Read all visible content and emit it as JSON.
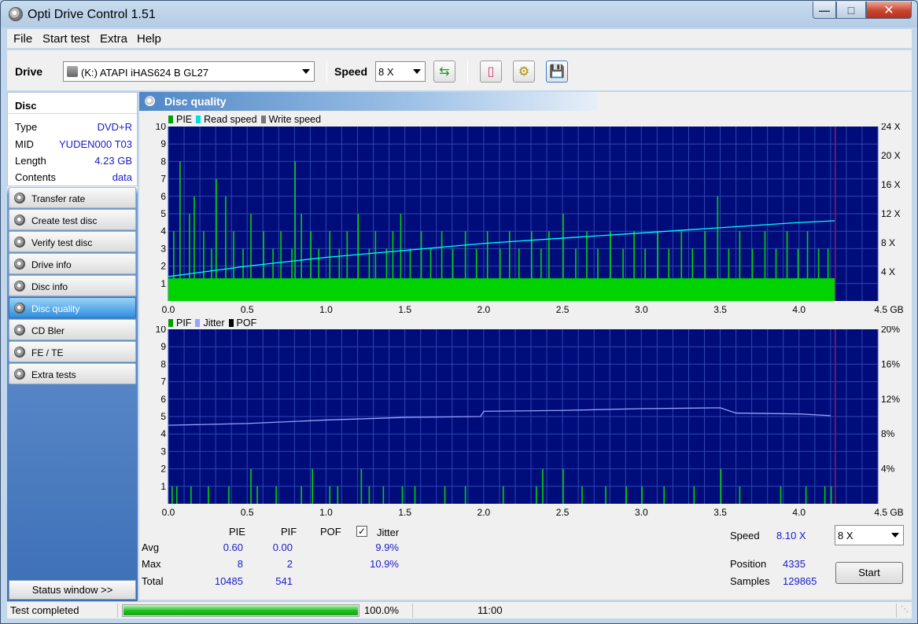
{
  "window": {
    "title": "Opti Drive Control 1.51"
  },
  "menu": [
    "File",
    "Start test",
    "Extra",
    "Help"
  ],
  "toolbar": {
    "drive_label": "Drive",
    "drive_value": "(K:)   ATAPI iHAS624   B GL27",
    "speed_label": "Speed",
    "speed_value": "8 X",
    "buttons": [
      "refresh-icon",
      "eraser-icon",
      "settings-icon",
      "save-icon"
    ]
  },
  "disc": {
    "title": "Disc",
    "rows": [
      {
        "label": "Type",
        "value": "DVD+R"
      },
      {
        "label": "MID",
        "value": "YUDEN000 T03"
      },
      {
        "label": "Length",
        "value": "4.23 GB"
      },
      {
        "label": "Contents",
        "value": "data"
      }
    ]
  },
  "nav": [
    {
      "label": "Transfer rate",
      "active": false
    },
    {
      "label": "Create test disc",
      "active": false
    },
    {
      "label": "Verify test disc",
      "active": false
    },
    {
      "label": "Drive info",
      "active": false
    },
    {
      "label": "Disc info",
      "active": false
    },
    {
      "label": "Disc quality",
      "active": true
    },
    {
      "label": "CD Bler",
      "active": false
    },
    {
      "label": "FE / TE",
      "active": false
    },
    {
      "label": "Extra tests",
      "active": false
    }
  ],
  "status_window_label": "Status window >>",
  "panel_title": "Disc quality",
  "colors": {
    "plot_bg": "#000c7a",
    "grid": "#2f46b4",
    "pie": "#00d400",
    "read_speed": "#00ffff",
    "jitter": "#9aa0ff",
    "end_line": "#8a1a6a"
  },
  "chart_data": [
    {
      "type": "bar",
      "legend": [
        "PIE",
        "Read speed",
        "Write speed"
      ],
      "xlim": [
        0,
        4.5
      ],
      "xticks": [
        "0.0",
        "0.5",
        "1.0",
        "1.5",
        "2.0",
        "2.5",
        "3.0",
        "3.5",
        "4.0",
        "4.5 GB"
      ],
      "ylim": [
        0,
        10
      ],
      "yticks": [
        "1",
        "2",
        "3",
        "4",
        "5",
        "6",
        "7",
        "8",
        "9",
        "10"
      ],
      "y2ticks": [
        "4 X",
        "8 X",
        "12 X",
        "16 X",
        "20 X",
        "24 X"
      ],
      "data_end": 4.23,
      "pie_base": 1.3,
      "pie_spikes": [
        [
          0.03,
          4
        ],
        [
          0.07,
          8
        ],
        [
          0.13,
          5
        ],
        [
          0.16,
          6
        ],
        [
          0.22,
          4
        ],
        [
          0.27,
          3
        ],
        [
          0.3,
          7
        ],
        [
          0.36,
          6
        ],
        [
          0.41,
          4
        ],
        [
          0.47,
          3
        ],
        [
          0.52,
          5
        ],
        [
          0.6,
          4
        ],
        [
          0.66,
          3
        ],
        [
          0.71,
          4
        ],
        [
          0.78,
          3
        ],
        [
          0.8,
          8
        ],
        [
          0.84,
          5
        ],
        [
          0.9,
          4
        ],
        [
          0.95,
          3
        ],
        [
          1.02,
          4
        ],
        [
          1.08,
          3
        ],
        [
          1.13,
          4
        ],
        [
          1.2,
          5
        ],
        [
          1.27,
          3
        ],
        [
          1.31,
          4
        ],
        [
          1.38,
          3
        ],
        [
          1.42,
          4
        ],
        [
          1.47,
          5
        ],
        [
          1.53,
          3
        ],
        [
          1.6,
          4
        ],
        [
          1.66,
          3
        ],
        [
          1.73,
          4
        ],
        [
          1.8,
          3
        ],
        [
          1.88,
          4
        ],
        [
          1.95,
          3
        ],
        [
          2.02,
          4
        ],
        [
          2.1,
          3
        ],
        [
          2.16,
          4
        ],
        [
          2.22,
          3
        ],
        [
          2.3,
          4
        ],
        [
          2.36,
          3
        ],
        [
          2.41,
          4
        ],
        [
          2.5,
          5
        ],
        [
          2.58,
          3
        ],
        [
          2.65,
          4
        ],
        [
          2.72,
          3
        ],
        [
          2.8,
          4
        ],
        [
          2.88,
          3
        ],
        [
          2.95,
          4
        ],
        [
          3.02,
          3
        ],
        [
          3.1,
          4
        ],
        [
          3.17,
          3
        ],
        [
          3.25,
          4
        ],
        [
          3.32,
          3
        ],
        [
          3.4,
          4
        ],
        [
          3.48,
          6
        ],
        [
          3.55,
          3
        ],
        [
          3.62,
          4
        ],
        [
          3.7,
          3
        ],
        [
          3.78,
          4
        ],
        [
          3.85,
          3
        ],
        [
          3.92,
          4
        ],
        [
          3.99,
          3
        ],
        [
          4.05,
          4
        ],
        [
          4.12,
          3
        ],
        [
          4.18,
          3
        ]
      ],
      "read_speed": [
        [
          0,
          1.4
        ],
        [
          0.5,
          2.0
        ],
        [
          1.0,
          2.5
        ],
        [
          1.5,
          2.9
        ],
        [
          2.0,
          3.3
        ],
        [
          2.5,
          3.6
        ],
        [
          3.0,
          3.9
        ],
        [
          3.5,
          4.2
        ],
        [
          4.0,
          4.5
        ],
        [
          4.23,
          4.6
        ]
      ]
    },
    {
      "type": "bar",
      "legend": [
        "PIF",
        "Jitter",
        "POF"
      ],
      "xlim": [
        0,
        4.5
      ],
      "xticks": [
        "0.0",
        "0.5",
        "1.0",
        "1.5",
        "2.0",
        "2.5",
        "3.0",
        "3.5",
        "4.0",
        "4.5 GB"
      ],
      "ylim": [
        0,
        10
      ],
      "yticks": [
        "1",
        "2",
        "3",
        "4",
        "5",
        "6",
        "7",
        "8",
        "9",
        "10"
      ],
      "y2ticks": [
        "4%",
        "8%",
        "12%",
        "16%",
        "20%"
      ],
      "data_end": 4.23,
      "pif_spikes": [
        [
          0.02,
          1
        ],
        [
          0.05,
          1
        ],
        [
          0.14,
          1
        ],
        [
          0.25,
          1
        ],
        [
          0.38,
          1
        ],
        [
          0.52,
          2
        ],
        [
          0.56,
          1
        ],
        [
          0.68,
          1
        ],
        [
          0.84,
          1
        ],
        [
          0.91,
          2
        ],
        [
          1.02,
          1
        ],
        [
          1.07,
          1
        ],
        [
          1.22,
          2
        ],
        [
          1.27,
          1
        ],
        [
          1.36,
          1
        ],
        [
          1.48,
          1
        ],
        [
          1.56,
          1
        ],
        [
          1.75,
          1
        ],
        [
          1.88,
          1
        ],
        [
          2.12,
          1
        ],
        [
          2.33,
          1
        ],
        [
          2.37,
          2
        ],
        [
          2.5,
          2
        ],
        [
          2.62,
          1
        ],
        [
          2.77,
          1
        ],
        [
          2.9,
          1
        ],
        [
          3.0,
          1
        ],
        [
          3.14,
          1
        ],
        [
          3.33,
          1
        ],
        [
          3.5,
          2
        ],
        [
          3.62,
          1
        ],
        [
          3.88,
          1
        ],
        [
          4.04,
          1
        ],
        [
          4.16,
          1
        ],
        [
          4.2,
          1
        ]
      ],
      "jitter": [
        [
          0,
          4.5
        ],
        [
          0.5,
          4.6
        ],
        [
          1.0,
          4.8
        ],
        [
          1.5,
          4.95
        ],
        [
          1.98,
          5.0
        ],
        [
          2.0,
          5.3
        ],
        [
          2.5,
          5.35
        ],
        [
          3.0,
          5.45
        ],
        [
          3.5,
          5.5
        ],
        [
          3.6,
          5.2
        ],
        [
          4.0,
          5.15
        ],
        [
          4.2,
          5.05
        ]
      ]
    }
  ],
  "stats": {
    "headers": [
      "PIE",
      "PIF",
      "POF",
      "Jitter"
    ],
    "jitter_checked": true,
    "rows": [
      {
        "label": "Avg",
        "pie": "0.60",
        "pif": "0.00",
        "jitter": "9.9%"
      },
      {
        "label": "Max",
        "pie": "8",
        "pif": "2",
        "jitter": "10.9%"
      },
      {
        "label": "Total",
        "pie": "10485",
        "pif": "541",
        "jitter": ""
      }
    ]
  },
  "run": {
    "speed_label": "Speed",
    "speed_value": "8.10 X",
    "speed_select": "8 X",
    "position_label": "Position",
    "position_value": "4335",
    "samples_label": "Samples",
    "samples_value": "129865",
    "start_label": "Start"
  },
  "status": {
    "text": "Test completed",
    "progress": 1.0,
    "progress_text": "100.0%",
    "time": "11:00"
  }
}
